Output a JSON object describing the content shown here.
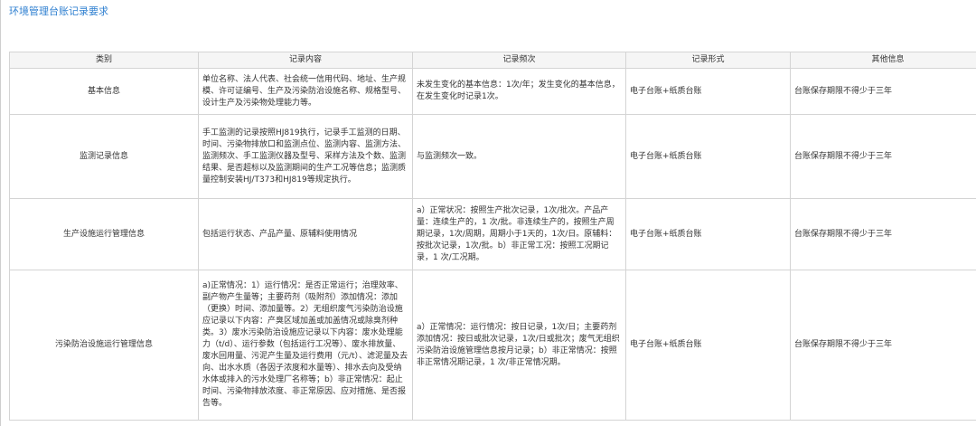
{
  "page_title": "环境管理台账记录要求",
  "table": {
    "headers": [
      "类别",
      "记录内容",
      "记录频次",
      "记录形式",
      "其他信息"
    ],
    "rows": [
      {
        "category": "基本信息",
        "content": "单位名称、法人代表、社会统一信用代码、地址、生产规模、许可证编号、生产及污染防治设施名称、规格型号、设计生产及污染物处理能力等。",
        "frequency": "未发生变化的基本信息：1次/年；发生变化的基本信息，在发生变化时记录1次。",
        "format": "电子台账+纸质台账",
        "other": "台账保存期限不得少于三年"
      },
      {
        "category": "监测记录信息",
        "content": "手工监测的记录按照HJ819执行，记录手工监测的日期、时间、污染物排放口和监测点位、监测内容、监测方法、监测频次、手工监测仪器及型号、采样方法及个数、监测结果、是否超标以及监测期间的生产工况等信息；监测质量控制安装HJ/T373和HJ819等规定执行。",
        "frequency": "与监测频次一致。",
        "format": "电子台账+纸质台账",
        "other": "台账保存期限不得少于三年"
      },
      {
        "category": "生产设施运行管理信息",
        "content": "包括运行状态、产品产量、原辅料使用情况",
        "frequency": "a）正常状况：按照生产批次记录，1次/批次。产品产量：连续生产的，1 次/批。非连续生产的，按照生产周期记录，1次/周期，周期小于1天的，1次/日。原辅料：按批次记录，1次/批。b）非正常工况：按照工况期记录，1 次/工况期。",
        "format": "电子台账+纸质台账",
        "other": "台账保存期限不得少于三年"
      },
      {
        "category": "污染防治设施运行管理信息",
        "content": "a)正常情况：1）运行情况：是否正常运行；治理效率、副产物产生量等；主要药剂（吸附剂）添加情况：添加（更换）时间、添加量等。2）无组织废气污染防治设施应记录以下内容：产臭区域加盖或加盖情况或除臭剂种类。3）废水污染防治设施应记录以下内容：废水处理能力（t/d）、运行参数（包括运行工况等）、废水排放量、废水回用量、污泥产生量及运行费用（元/t）、滤泥量及去向、出水水质（各因子浓度和水量等）、排水去向及受纳水体或排入的污水处理厂名称等；b）非正常情况：起止时间、污染物排放浓度、非正常原因、应对措施、是否报告等。",
        "frequency": "a）正常情况：运行情况：按日记录，1次/日；主要药剂添加情况：按日或批次记录，1次/日或批次；废气无组织污染防治设施管理信息按月记录；b）非正常情况：按照非正常情况期记录，1 次/非正常情况期。",
        "format": "电子台账+纸质台账",
        "other": "台账保存期限不得少于三年"
      }
    ]
  }
}
